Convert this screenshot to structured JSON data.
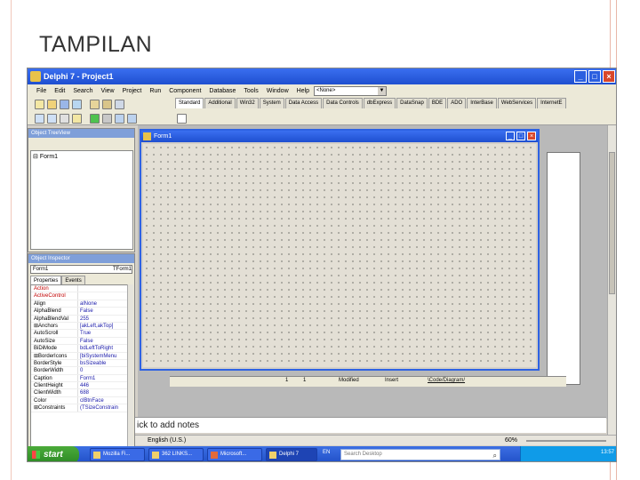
{
  "slide": {
    "title": "TAMPILAN"
  },
  "delphi": {
    "window_title": "Delphi 7 - Project1",
    "menu": [
      "File",
      "Edit",
      "Search",
      "View",
      "Project",
      "Run",
      "Component",
      "Database",
      "Tools",
      "Window",
      "Help"
    ],
    "combo_value": "<None>",
    "palette_tabs": [
      "Standard",
      "Additional",
      "Win32",
      "System",
      "Data Access",
      "Data Controls",
      "dbExpress",
      "DataSnap",
      "BDE",
      "ADO",
      "InterBase",
      "WebServices",
      "InternetE"
    ],
    "treeview": {
      "title": "Object TreeView",
      "item": "Form1"
    },
    "inspector": {
      "title": "Object Inspector",
      "selected": "Form1",
      "selected_type": "TForm1",
      "tabs": [
        "Properties",
        "Events"
      ],
      "rows": [
        {
          "k": "Action",
          "v": "",
          "red": true
        },
        {
          "k": "ActiveControl",
          "v": "",
          "red": true
        },
        {
          "k": "Align",
          "v": "alNone",
          "red": false
        },
        {
          "k": "AlphaBlend",
          "v": "False",
          "red": false
        },
        {
          "k": "AlphaBlendVal",
          "v": "255",
          "red": false
        },
        {
          "k": "⊞Anchors",
          "v": "[akLeft,akTop]",
          "red": false
        },
        {
          "k": "AutoScroll",
          "v": "True",
          "red": false
        },
        {
          "k": "AutoSize",
          "v": "False",
          "red": false
        },
        {
          "k": "BiDiMode",
          "v": "bdLeftToRight",
          "red": false
        },
        {
          "k": "⊞BorderIcons",
          "v": "[biSystemMenu",
          "red": false
        },
        {
          "k": "BorderStyle",
          "v": "bsSizeable",
          "red": false
        },
        {
          "k": "BorderWidth",
          "v": "0",
          "red": false
        },
        {
          "k": "Caption",
          "v": "Form1",
          "red": false
        },
        {
          "k": "ClientHeight",
          "v": "446",
          "red": false
        },
        {
          "k": "ClientWidth",
          "v": "688",
          "red": false
        },
        {
          "k": "Color",
          "v": "clBtnFace",
          "red": false
        },
        {
          "k": "⊞Constraints",
          "v": "(TSizeConstrain",
          "red": false
        }
      ]
    },
    "form": {
      "title": "Form1"
    },
    "status": {
      "line": "1",
      "col": "1",
      "mode": "Modified",
      "insert": "Insert",
      "tabs": "\\Code/Diagram/"
    }
  },
  "powerpoint": {
    "notes_placeholder": "ick to add notes",
    "language": "English (U.S.)",
    "zoom": "60%"
  },
  "taskbar": {
    "start_label": "start",
    "items": [
      "Mozilla Fi...",
      "362 LINKS...",
      "Microsoft...",
      "Delphi 7"
    ],
    "tray_label": "EN",
    "search_placeholder": "Search Desktop",
    "clock": "13:57"
  }
}
